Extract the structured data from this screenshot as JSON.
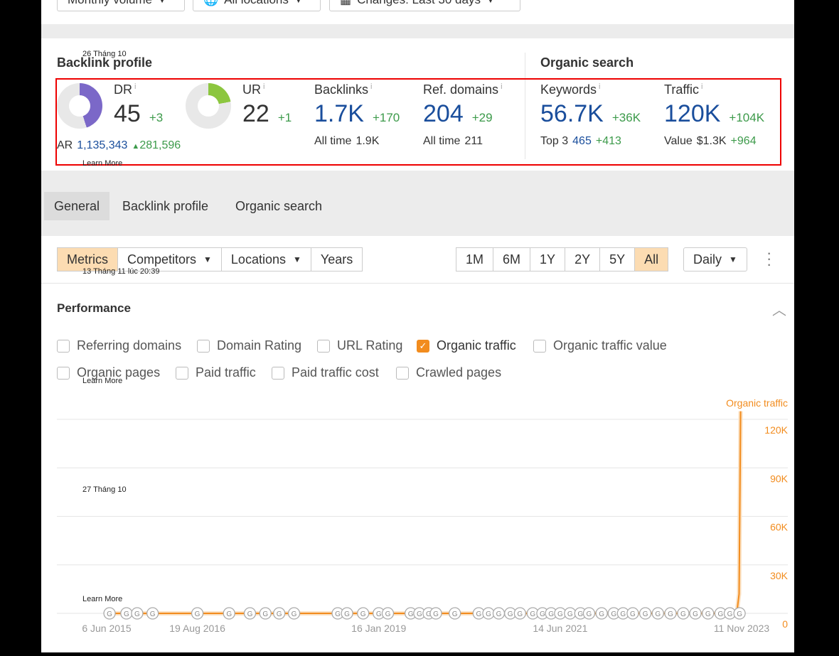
{
  "top_filters": [
    {
      "label": "Monthly volume",
      "icon": "caret-down-icon"
    },
    {
      "label": "All locations",
      "icon": "globe-icon"
    },
    {
      "label": "Changes: Last 30 days",
      "icon": "calendar-icon"
    }
  ],
  "backlink_profile": {
    "title": "Backlink profile",
    "dr": {
      "label": "DR",
      "value": "45",
      "delta": "+3",
      "fill": 0.45,
      "color": "#7b68c8"
    },
    "ar": {
      "label": "AR",
      "value": "1,135,343",
      "delta": "281,596"
    },
    "ur": {
      "label": "UR",
      "value": "22",
      "delta": "+1",
      "fill": 0.22,
      "color": "#8cc63f"
    },
    "backlinks": {
      "label": "Backlinks",
      "value": "1.7K",
      "delta": "+170",
      "sub_label": "All time",
      "sub_value": "1.9K"
    },
    "ref_domains": {
      "label": "Ref. domains",
      "value": "204",
      "delta": "+29",
      "sub_label": "All time",
      "sub_value": "211"
    }
  },
  "organic_search": {
    "title": "Organic search",
    "keywords": {
      "label": "Keywords",
      "value": "56.7K",
      "delta": "+36K",
      "sub_label": "Top 3",
      "sub_value": "465",
      "sub_delta": "+413"
    },
    "traffic": {
      "label": "Traffic",
      "value": "120K",
      "delta": "+104K",
      "sub_label": "Value",
      "sub_value": "$1.3K",
      "sub_delta": "+964"
    }
  },
  "tabs": [
    {
      "label": "General",
      "selected": true
    },
    {
      "label": "Backlink profile"
    },
    {
      "label": "Organic search"
    }
  ],
  "toolbar": {
    "left": [
      "Metrics",
      "Competitors",
      "Locations",
      "Years"
    ],
    "ranges": [
      "1M",
      "6M",
      "1Y",
      "2Y",
      "5Y",
      "All"
    ],
    "selected_range": "All",
    "interval": "Daily"
  },
  "performance": {
    "title": "Performance",
    "checkboxes": [
      {
        "label": "Referring domains",
        "checked": false
      },
      {
        "label": "Domain Rating",
        "checked": false
      },
      {
        "label": "URL Rating",
        "checked": false
      },
      {
        "label": "Organic traffic",
        "checked": true
      },
      {
        "label": "Organic traffic value",
        "checked": false
      },
      {
        "label": "Organic pages",
        "checked": false
      },
      {
        "label": "Paid traffic",
        "checked": false
      },
      {
        "label": "Paid traffic cost",
        "checked": false
      },
      {
        "label": "Crawled pages",
        "checked": false
      }
    ]
  },
  "overlays": [
    "26 Tháng 10",
    "Learn More",
    "13 Tháng 11 lúc 20:39",
    "Learn More",
    "27 Tháng 10",
    "Learn More"
  ],
  "chart_data": {
    "type": "line",
    "series": [
      {
        "name": "Organic traffic",
        "color": "#f28c1e",
        "x": [
          "2015-06-06",
          "2016-08-19",
          "2019-01-16",
          "2021-06-14",
          "2023-09-15",
          "2023-10-20",
          "2023-10-30",
          "2023-11-06"
        ],
        "y": [
          0,
          0,
          0,
          0,
          0,
          1500,
          12000,
          125000
        ]
      }
    ],
    "x_ticks": [
      "6 Jun 2015",
      "19 Aug 2016",
      "16 Jan 2019",
      "14 Jun 2021",
      "11 Nov 2023"
    ],
    "y_ticks": [
      "0",
      "30K",
      "60K",
      "90K",
      "120K"
    ],
    "ylim": [
      0,
      120000
    ],
    "grid": true,
    "annotation_marker": "G",
    "annotation_dates": [
      "2015-06-20",
      "2015-09-10",
      "2015-11-01",
      "2016-01-15",
      "2016-08-19",
      "2017-01-20",
      "2017-05-01",
      "2017-07-15",
      "2017-09-20",
      "2017-12-01",
      "2018-07-01",
      "2018-08-15",
      "2018-11-01",
      "2019-01-16",
      "2019-03-01",
      "2019-06-20",
      "2019-08-01",
      "2019-09-15",
      "2019-10-20",
      "2020-01-20",
      "2020-05-15",
      "2020-07-01",
      "2020-08-20",
      "2020-10-15",
      "2020-12-01",
      "2021-02-01",
      "2021-03-20",
      "2021-05-01",
      "2021-06-14",
      "2021-08-01",
      "2021-09-20",
      "2021-11-01",
      "2022-01-01",
      "2022-03-01",
      "2022-04-15",
      "2022-06-01",
      "2022-08-01",
      "2022-10-01",
      "2022-12-01",
      "2023-02-01",
      "2023-04-01",
      "2023-06-01",
      "2023-08-01",
      "2023-09-15",
      "2023-11-01"
    ]
  }
}
